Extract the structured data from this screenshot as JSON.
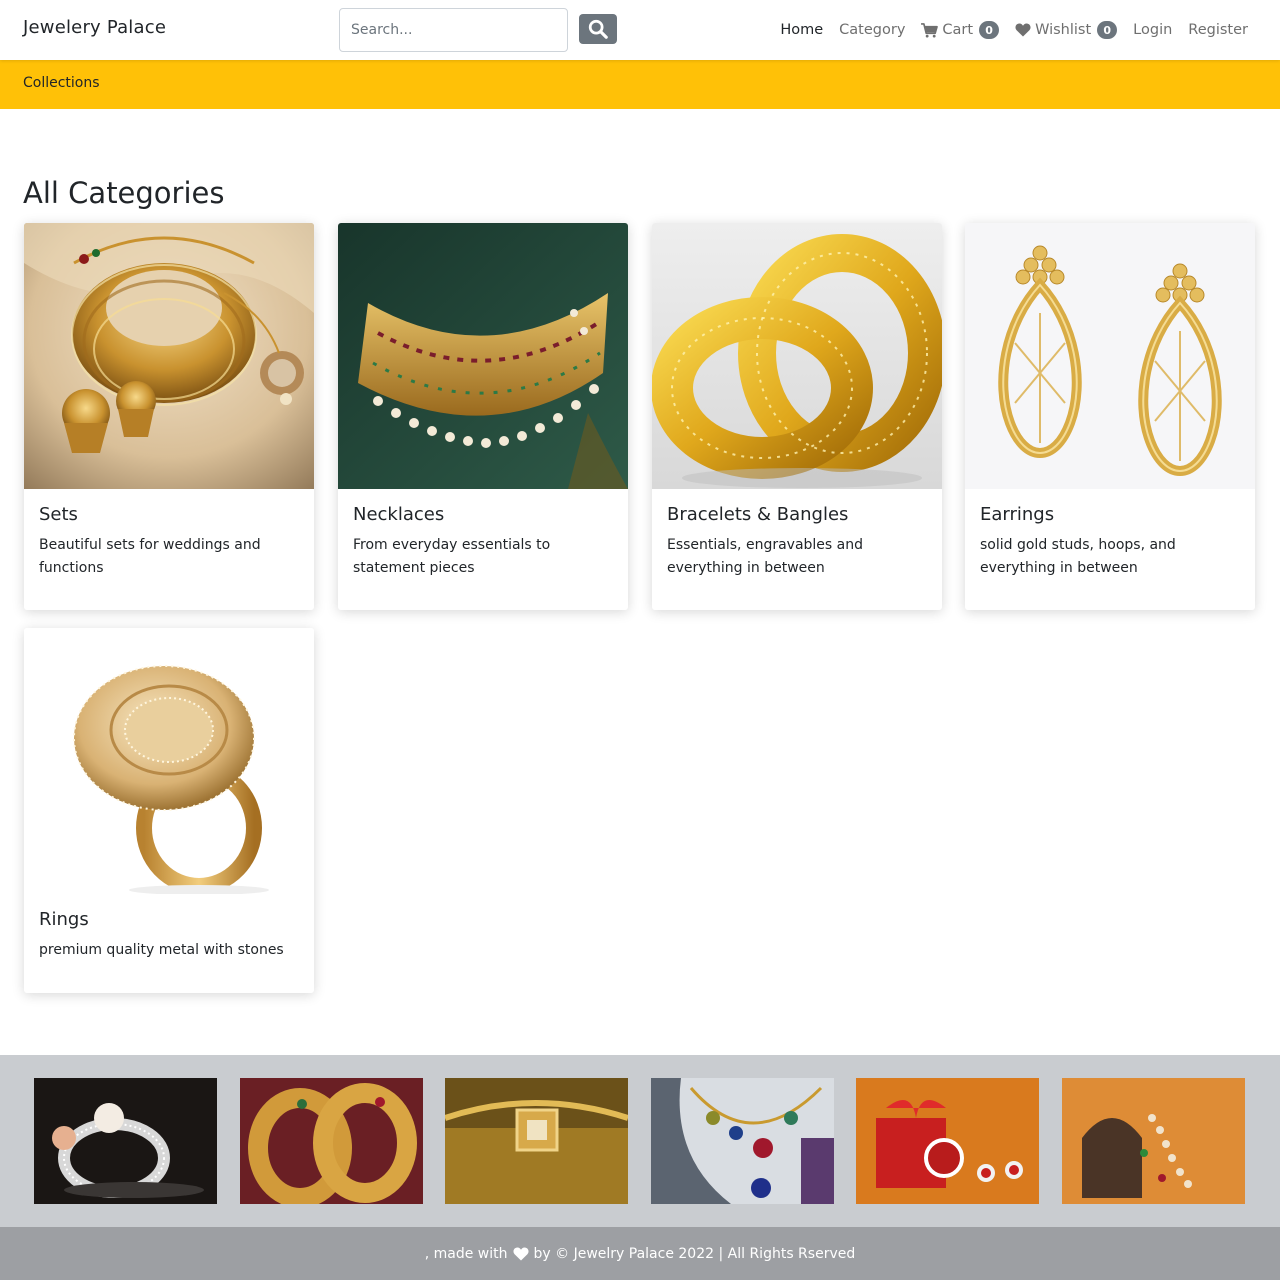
{
  "brand": "Jewelery Palace",
  "search": {
    "placeholder": "Search..."
  },
  "nav": {
    "home": "Home",
    "category": "Category",
    "cart": "Cart",
    "cart_count": "0",
    "wishlist": "Wishlist",
    "wishlist_count": "0",
    "login": "Login",
    "register": "Register"
  },
  "subnav": {
    "collections": "Collections"
  },
  "section_title": "All Categories",
  "categories": [
    {
      "title": "Sets",
      "description": "Beautiful sets for weddings and functions"
    },
    {
      "title": "Necklaces",
      "description": "From everyday essentials to statement pieces"
    },
    {
      "title": "Bracelets & Bangles",
      "description": "Essentials, engravables and everything in between"
    },
    {
      "title": "Earrings",
      "description": "solid gold studs, hoops, and everything in between"
    },
    {
      "title": "Rings",
      "description": "premium quality metal with stones"
    }
  ],
  "footer": {
    "prefix": ", made with",
    "suffix": "by © Jewelry Palace 2022 | All Rights Rserved"
  },
  "colors": {
    "accent_yellow": "#ffc107",
    "badge_gray": "#6c757d",
    "gallery_bg": "#c9ccd0",
    "footer_bg": "#9d9fa3"
  },
  "icons": {
    "search": "search-icon",
    "cart": "shopping-cart-icon",
    "wishlist": "heart-icon",
    "footer": "heart-icon"
  }
}
